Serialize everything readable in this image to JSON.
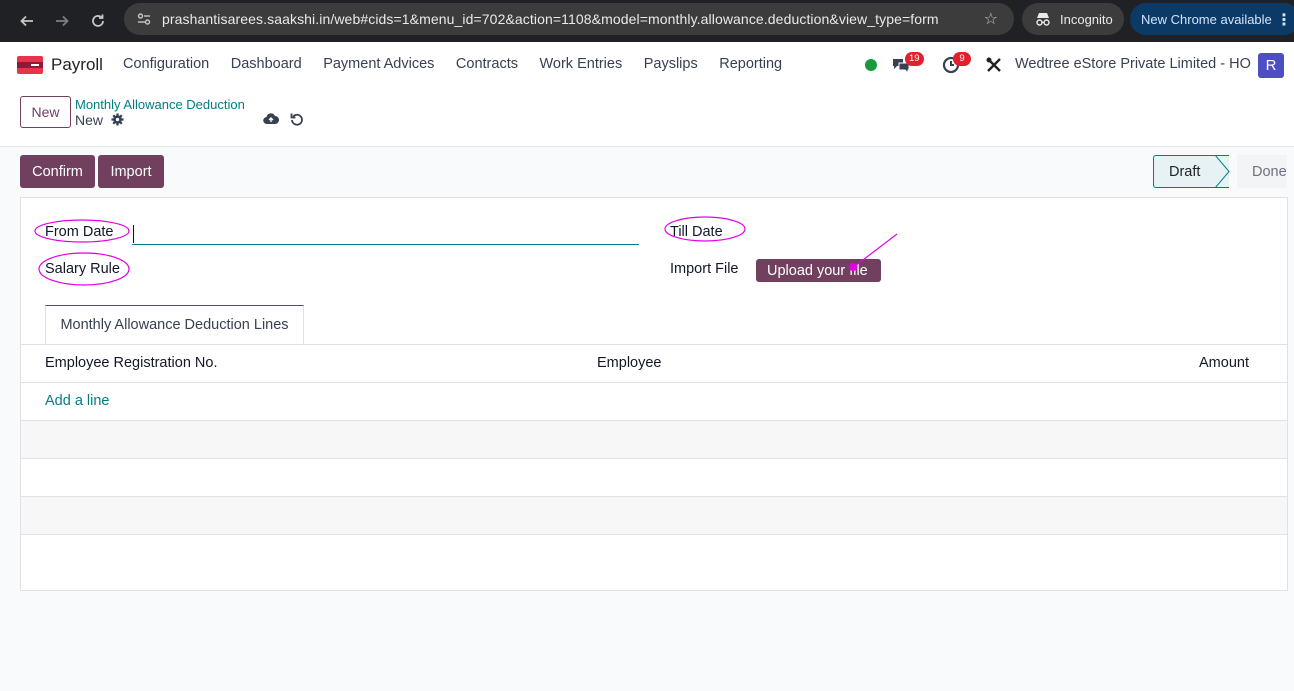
{
  "browser": {
    "url": "prashantisarees.saakshi.in/web#cids=1&menu_id=702&action=1108&model=monthly.allowance.deduction&view_type=form",
    "incognito_label": "Incognito",
    "update_label": "New Chrome available"
  },
  "navbar": {
    "app_name": "Payroll",
    "menu": [
      "Configuration",
      "Dashboard",
      "Payment Advices",
      "Contracts",
      "Work Entries",
      "Payslips",
      "Reporting"
    ],
    "messages_badge": "19",
    "activities_badge": "9",
    "company": "Wedtree eStore Private Limited - HO",
    "avatar_letter": "R",
    "status_color": "#1a9b3b"
  },
  "control_panel": {
    "new_button": "New",
    "breadcrumb": "Monthly Allowance Deduction",
    "record_name": "New"
  },
  "actions": {
    "confirm": "Confirm",
    "import": "Import",
    "states": [
      "Draft",
      "Done"
    ],
    "active_state": "Draft"
  },
  "form": {
    "from_date_label": "From Date",
    "till_date_label": "Till Date",
    "salary_rule_label": "Salary Rule",
    "import_file_label": "Import File",
    "upload_button": "Upload your file",
    "tab_label": "Monthly Allowance Deduction Lines",
    "columns": [
      "Employee Registration No.",
      "Employee",
      "Amount"
    ],
    "add_line": "Add a line"
  },
  "theme": {
    "primary": "#71405f",
    "link": "#017e84",
    "annotation": "#e600e6"
  }
}
